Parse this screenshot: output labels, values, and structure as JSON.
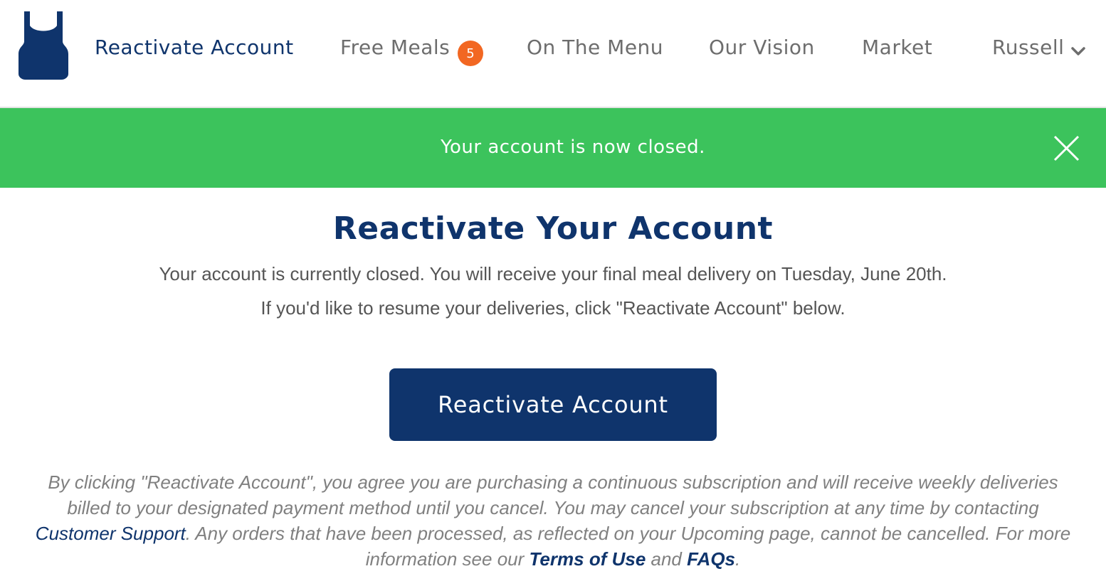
{
  "nav": {
    "logo_icon": "apron-icon",
    "active_item": "Reactivate Account",
    "items": [
      "Free Meals",
      "On The Menu",
      "Our Vision",
      "Market"
    ],
    "free_meals_badge": "5",
    "user_name": "Russell",
    "user_menu_icon": "chevron-down-icon"
  },
  "banner": {
    "message": "Your account is now closed.",
    "close_icon": "close-icon"
  },
  "main": {
    "title": "Reactivate Your Account",
    "line1": "Your account is currently closed. You will receive your final meal delivery on Tuesday, June 20th.",
    "line2": "If you'd like to resume your deliveries, click \"Reactivate Account\" below.",
    "button_label": "Reactivate Account"
  },
  "legal": {
    "part1": "By clicking \"Reactivate Account\", you agree you are purchasing a continuous subscription and will receive weekly deliveries billed to your designated payment method until you cancel. You may cancel your subscription at any time by contacting ",
    "support_link": "Customer Support",
    "part2": ". Any orders that have been processed, as reflected on your Upcoming page, cannot be cancelled. For more information see our ",
    "terms_link": "Terms of Use",
    "part3": " and ",
    "faq_link": "FAQs",
    "part4": "."
  },
  "colors": {
    "brand_navy": "#0f346c",
    "success_green": "#3cc35c",
    "badge_orange": "#f26722",
    "nav_gray": "#6d6d6d"
  }
}
